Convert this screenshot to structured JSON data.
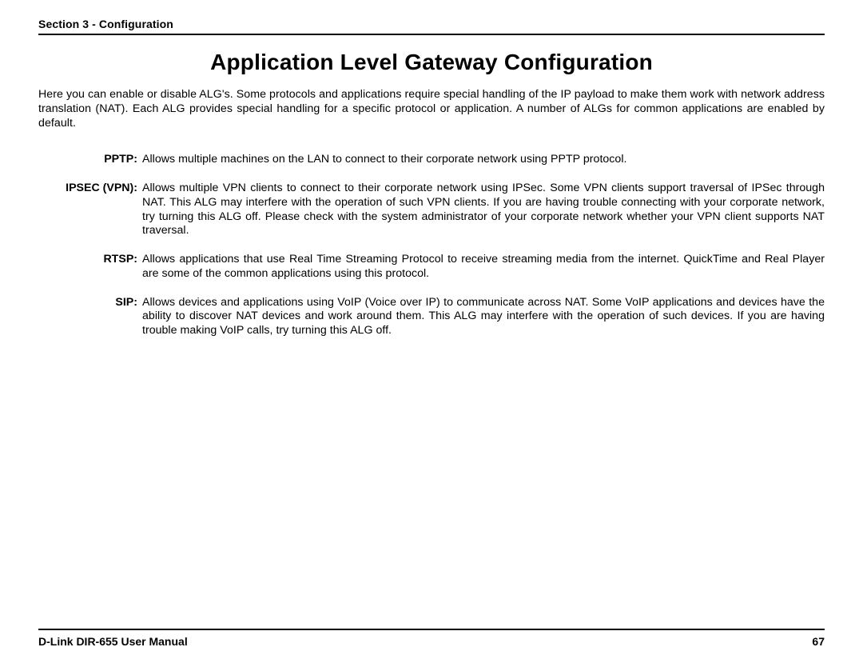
{
  "header": {
    "section_label": "Section 3 - Configuration"
  },
  "title": "Application Level Gateway Configuration",
  "intro": "Here you can enable or disable ALG's. Some protocols and applications require special handling of the IP payload to make them work with network address translation (NAT). Each ALG provides special handling for a specific protocol or application. A number of ALGs for common applications are enabled by default.",
  "definitions": [
    {
      "term": "PPTP:",
      "desc": "Allows multiple machines on the LAN to connect to their corporate network using PPTP protocol."
    },
    {
      "term": "IPSEC (VPN):",
      "desc": "Allows multiple VPN clients to connect to their corporate network using IPSec. Some VPN clients support traversal of IPSec through NAT. This ALG may interfere with the operation of such VPN clients. If you are having trouble connecting with your corporate network, try turning this ALG off. Please check with the system administrator of your corporate network whether your VPN client supports NAT traversal."
    },
    {
      "term": "RTSP:",
      "desc": "Allows applications that use Real Time Streaming Protocol to receive streaming media from the internet. QuickTime and Real Player are some of the common applications using this protocol."
    },
    {
      "term": "SIP:",
      "desc": "Allows devices and applications using VoIP (Voice over IP) to communicate across NAT. Some VoIP applications and devices have the ability to discover NAT devices and work around them. This ALG may interfere with the operation of such devices. If you are having trouble making VoIP calls, try turning this ALG off."
    }
  ],
  "footer": {
    "manual": "D-Link DIR-655 User Manual",
    "page": "67"
  }
}
